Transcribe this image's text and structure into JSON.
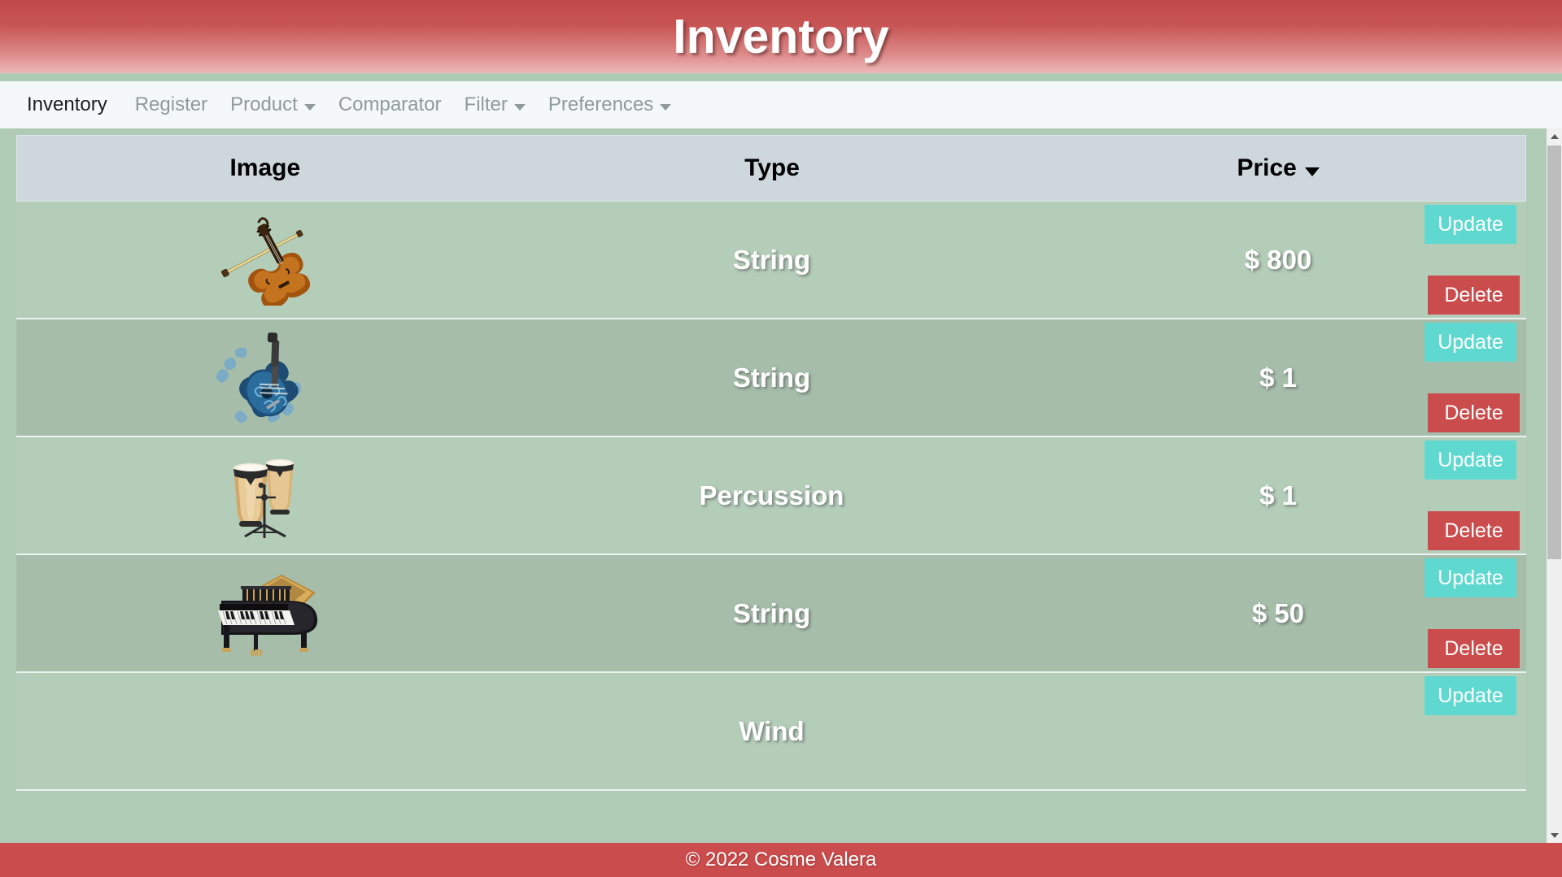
{
  "header": {
    "title": "Inventory",
    "bg_gradient_top": "#c04a4a",
    "bg_gradient_bottom": "#efb9b9"
  },
  "navbar": {
    "items": [
      {
        "label": "Inventory",
        "active": true,
        "has_caret": false
      },
      {
        "label": "Register",
        "active": false,
        "has_caret": false
      },
      {
        "label": "Product",
        "active": false,
        "has_caret": true
      },
      {
        "label": "Comparator",
        "active": false,
        "has_caret": false
      },
      {
        "label": "Filter",
        "active": false,
        "has_caret": true
      },
      {
        "label": "Preferences",
        "active": false,
        "has_caret": true
      }
    ]
  },
  "table": {
    "columns": [
      {
        "key": "image",
        "label": "Image",
        "sorted": false
      },
      {
        "key": "type",
        "label": "Type",
        "sorted": false
      },
      {
        "key": "price",
        "label": "Price",
        "sorted": true,
        "sort_direction": "desc"
      }
    ],
    "row_actions": {
      "update_label": "Update",
      "delete_label": "Delete",
      "update_color": "#5fd9cf",
      "delete_color": "#cb4c4c"
    },
    "rows": [
      {
        "image_name": "violin-image",
        "type": "String",
        "price": "$ 800"
      },
      {
        "image_name": "blue-guitar-image",
        "type": "String",
        "price": "$ 1"
      },
      {
        "image_name": "congas-image",
        "type": "Percussion",
        "price": "$ 1"
      },
      {
        "image_name": "grand-piano-image",
        "type": "String",
        "price": "$ 50"
      },
      {
        "image_name": "wind-instrument-image",
        "type": "Wind",
        "price": ""
      }
    ]
  },
  "scrollbar": {
    "up_arrow": "scroll-up-arrow",
    "down_arrow": "scroll-down-arrow",
    "thumb_position_percent": 0,
    "thumb_size_percent": 58
  },
  "footer": {
    "text": "© 2022 Cosme Valera",
    "bg": "#cb4c4c"
  }
}
